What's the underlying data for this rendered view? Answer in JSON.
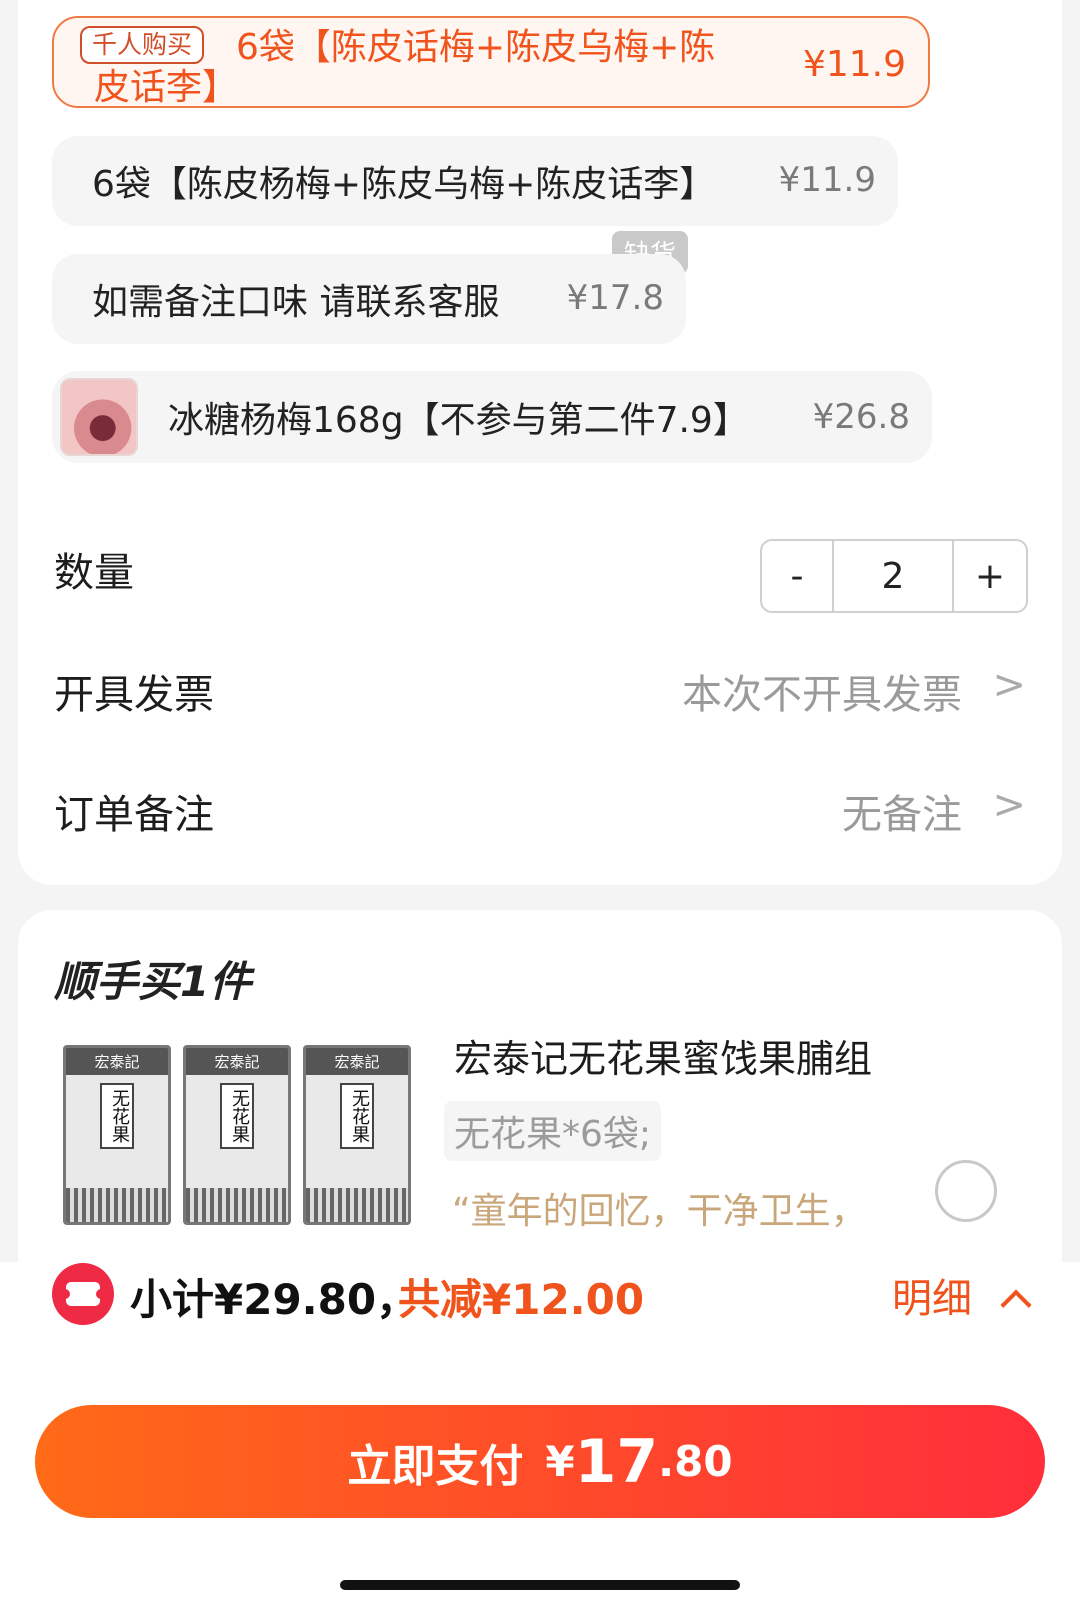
{
  "sku_options": [
    {
      "tag": "千人购买",
      "name_line1": "6袋【陈皮话梅+陈皮乌梅+陈",
      "name_line2": "皮话李】",
      "price": "¥11.9",
      "selected": true
    },
    {
      "name": "6袋【陈皮杨梅+陈皮乌梅+陈皮话李】",
      "price": "¥11.9"
    },
    {
      "badge": "缺货",
      "name": "如需备注口味 请联系客服",
      "price": "¥17.8"
    },
    {
      "name": "冰糖杨梅168g【不参与第二件7.9】",
      "price": "¥26.8"
    }
  ],
  "quantity": {
    "label": "数量",
    "minus": "-",
    "value": "2",
    "plus": "+"
  },
  "invoice": {
    "label": "开具发票",
    "value": "本次不开具发票",
    "chevron": ">"
  },
  "remark": {
    "label": "订单备注",
    "value": "无备注",
    "chevron": ">"
  },
  "upsell": {
    "title": "顺手买1件",
    "product_name": "宏泰记无花果蜜饯果脯组",
    "spec": "无花果*6袋;",
    "slogan": "“童年的回忆，干净卫生，",
    "image_text": {
      "brand": "宏泰記",
      "name": "无花果"
    }
  },
  "summary": {
    "subtotal": "小计¥29.80，",
    "discount": "共减¥12.00",
    "detail": "明细",
    "detail_chevron": "^"
  },
  "pay_button": {
    "label": "立即支付",
    "currency": "¥",
    "amount_int": "17",
    "amount_dec": ".80"
  },
  "colors": {
    "accent": "#f0531c",
    "pay_gradient_start": "#ff6a17",
    "pay_gradient_end": "#ff2e3b"
  }
}
